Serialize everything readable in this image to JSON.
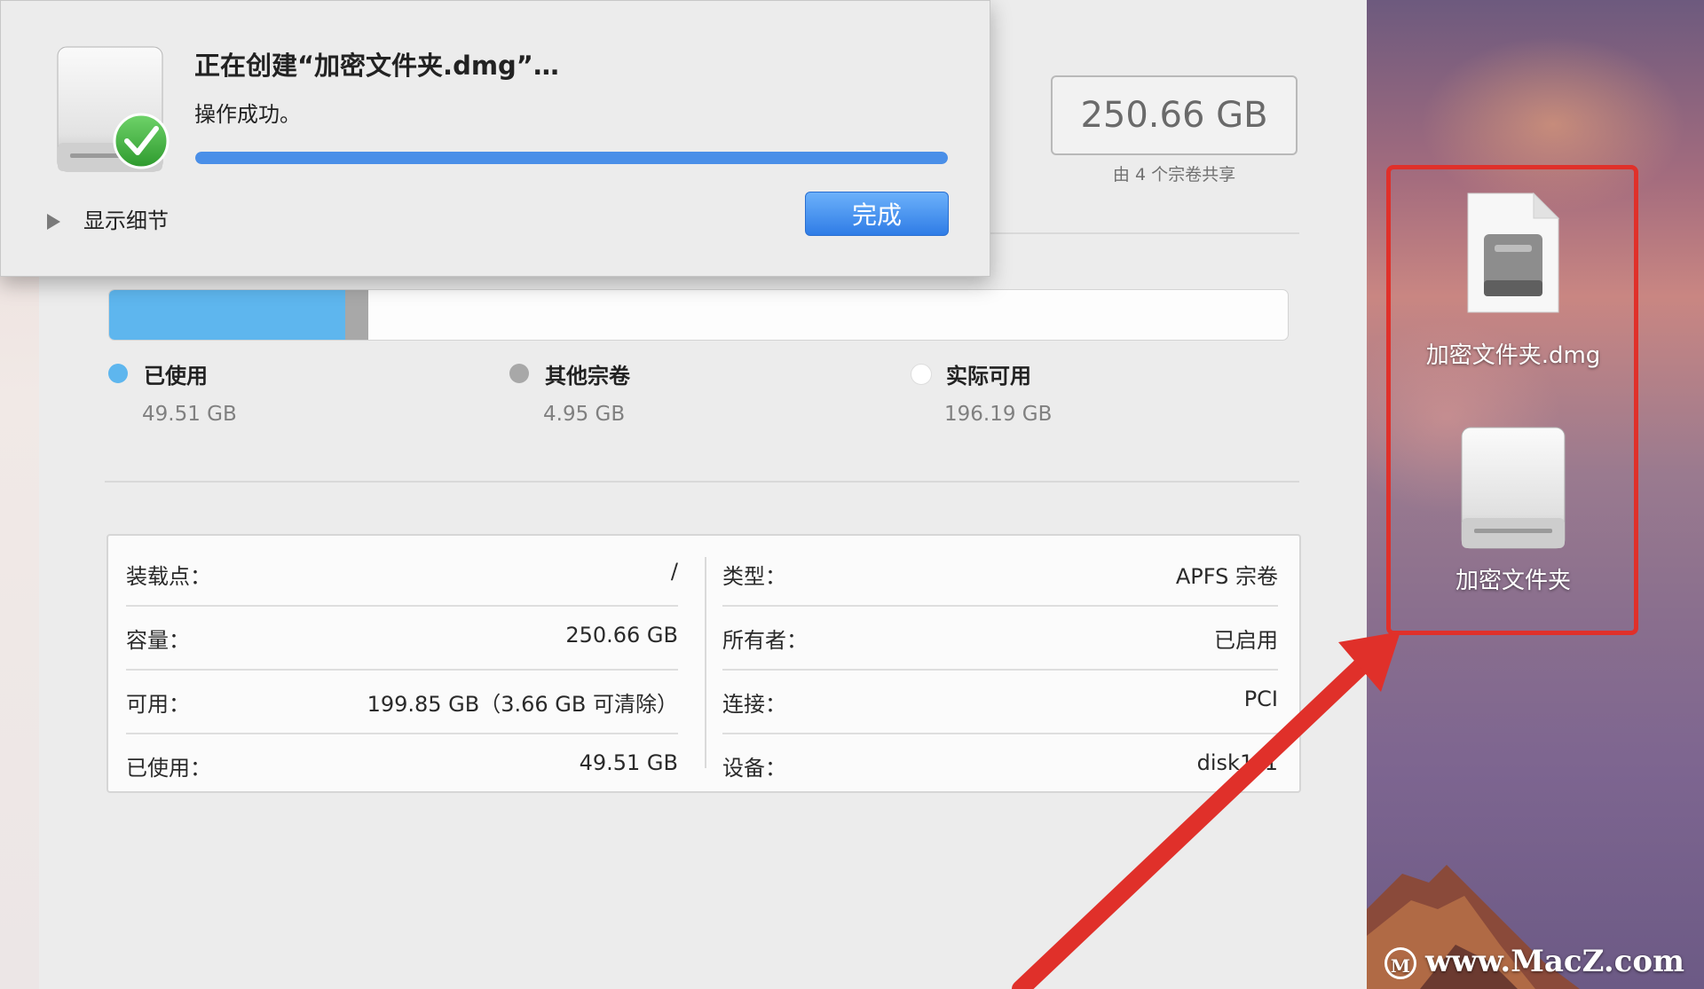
{
  "dialog": {
    "title": "正在创建“加密文件夹.dmg”…",
    "status": "操作成功。",
    "progress": 1.0,
    "details_label": "显示细节",
    "done_label": "完成"
  },
  "capacity": {
    "total": "250.66 GB",
    "shared_note": "由 4 个宗卷共享"
  },
  "usage": {
    "used_fraction": 0.2,
    "other_fraction": 0.02,
    "legend": [
      {
        "label": "已使用",
        "value": "49.51 GB",
        "color": "#5eb6ee"
      },
      {
        "label": "其他宗卷",
        "value": "4.95 GB",
        "color": "#a8a8a8"
      },
      {
        "label": "实际可用",
        "value": "196.19 GB",
        "color": "#ffffff"
      }
    ]
  },
  "info": {
    "left": [
      {
        "key": "装载点：",
        "value": "/"
      },
      {
        "key": "容量：",
        "value": "250.66 GB"
      },
      {
        "key": "可用：",
        "value": "199.85 GB（3.66 GB 可清除）"
      },
      {
        "key": "已使用：",
        "value": "49.51 GB"
      }
    ],
    "right": [
      {
        "key": "类型：",
        "value": "APFS 宗卷"
      },
      {
        "key": "所有者：",
        "value": "已启用"
      },
      {
        "key": "连接：",
        "value": "PCI"
      },
      {
        "key": "设备：",
        "value": "disk1s1"
      }
    ]
  },
  "desktop": {
    "icons": [
      {
        "label": "加密文件夹.dmg",
        "icon": "dmg-file-icon"
      },
      {
        "label": "加密文件夹",
        "icon": "mounted-disk-icon"
      }
    ],
    "watermark": "www.MacZ.com",
    "annotation_color": "#e0302a"
  }
}
